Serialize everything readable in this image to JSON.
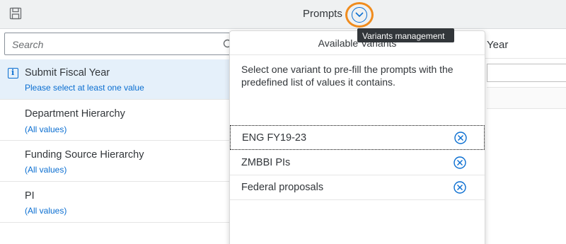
{
  "header": {
    "title": "Prompts",
    "save_icon": "save-icon",
    "variant_button_icon": "chevron-down-circle-icon",
    "tooltip": "Variants management"
  },
  "search": {
    "placeholder": "Search",
    "icon": "search-icon"
  },
  "prompts": [
    {
      "title": "Submit Fiscal Year",
      "subtitle": "Please select at least one value",
      "selected": true,
      "icon": "info-icon"
    },
    {
      "title": "Department Hierarchy",
      "subtitle": "(All values)"
    },
    {
      "title": "Funding Source Hierarchy",
      "subtitle": "(All values)"
    },
    {
      "title": "PI",
      "subtitle": "(All values)"
    }
  ],
  "right_panel": {
    "header_text": "Year"
  },
  "popover": {
    "title": "Available Variants",
    "description": "Select one variant to pre-fill the prompts with the predefined list of values it contains.",
    "variants": [
      {
        "label": "ENG FY19-23",
        "focused": true
      },
      {
        "label": "ZMBBI PIs"
      },
      {
        "label": "Federal proposals"
      }
    ],
    "delete_icon": "delete-circle-icon"
  },
  "colors": {
    "accent": "#0a6ed1",
    "highlight_ring": "#f08c1e",
    "selected_row": "#e5f0fa",
    "header_bg": "#eff1f2",
    "tooltip_bg": "#32363a"
  }
}
